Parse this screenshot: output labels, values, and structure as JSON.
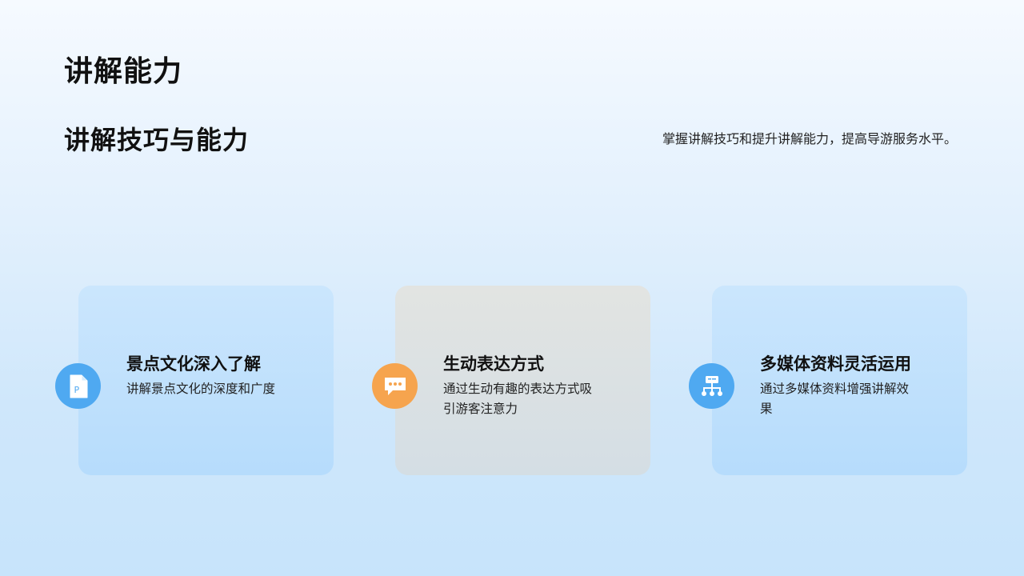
{
  "page": {
    "title": "讲解能力"
  },
  "section": {
    "title": "讲解技巧与能力",
    "description": "掌握讲解技巧和提升讲解能力，提高导游服务水平。"
  },
  "cards": [
    {
      "title": "景点文化深入了解",
      "text": "讲解景点文化的深度和广度",
      "icon": "document-icon",
      "icon_color": "#4fa9f1"
    },
    {
      "title": "生动表达方式",
      "text": "通过生动有趣的表达方式吸引游客注意力",
      "icon": "chat-bubble-icon",
      "icon_color": "#f6a44e"
    },
    {
      "title": "多媒体资料灵活运用",
      "text": "通过多媒体资料增强讲解效果",
      "icon": "network-icon",
      "icon_color": "#4fa9f1"
    }
  ]
}
